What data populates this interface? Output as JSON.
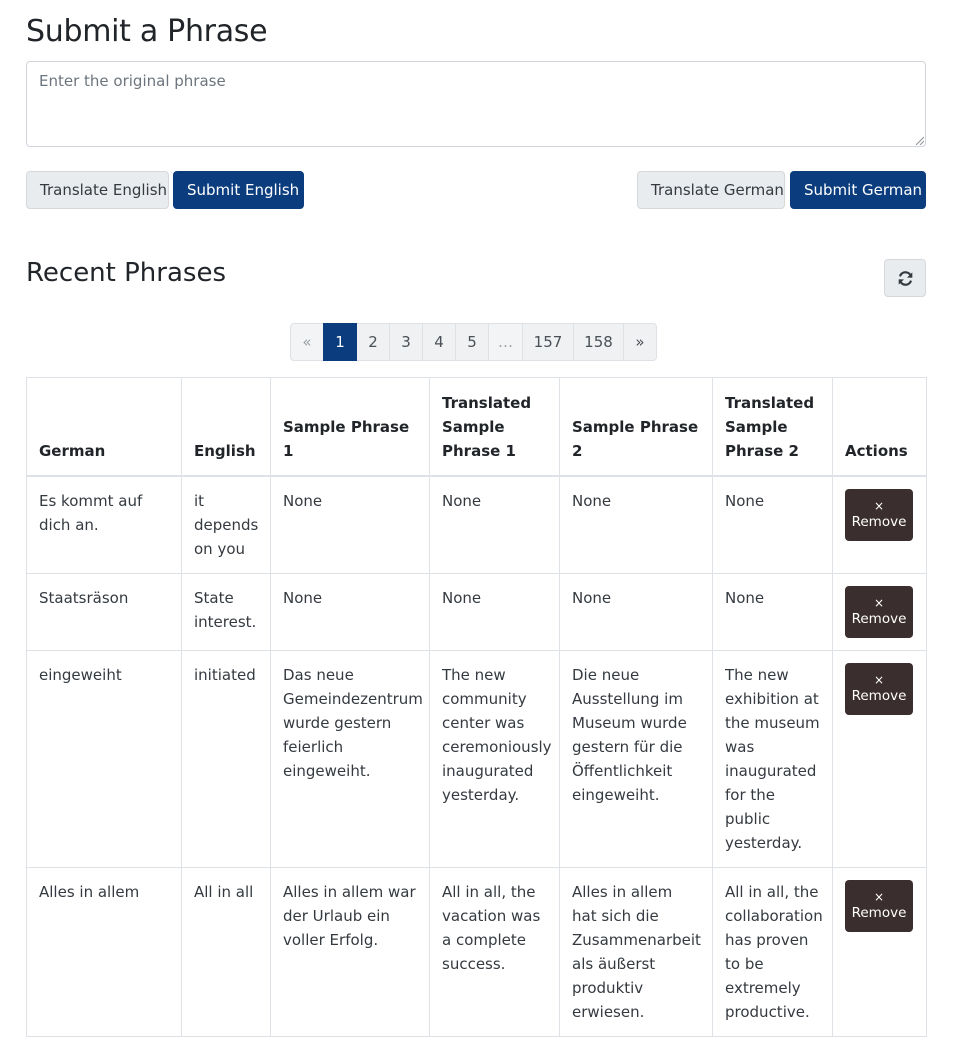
{
  "form": {
    "title": "Submit a Phrase",
    "placeholder": "Enter the original phrase",
    "translate_english": "Translate English",
    "submit_english": "Submit English",
    "translate_german": "Translate German",
    "submit_german": "Submit German"
  },
  "recent": {
    "title": "Recent Phrases"
  },
  "pagination": {
    "prev": "«",
    "next": "»",
    "pages": [
      "1",
      "2",
      "3",
      "4",
      "5",
      "…",
      "157",
      "158"
    ],
    "current": "1"
  },
  "table": {
    "headers": [
      "German",
      "English",
      "Sample Phrase 1",
      "Translated Sample Phrase 1",
      "Sample Phrase 2",
      "Translated Sample Phrase 2",
      "Actions"
    ],
    "remove_icon": "×",
    "remove_label": "Remove",
    "rows": [
      [
        "Es kommt auf dich an.",
        "it depends on you",
        "None",
        "None",
        "None",
        "None"
      ],
      [
        "Staatsräson",
        "State interest.",
        "None",
        "None",
        "None",
        "None"
      ],
      [
        "eingeweiht",
        "initiated",
        "Das neue Gemeindezentrum wurde gestern feierlich eingeweiht.",
        "The new community center was ceremoniously inaugurated yesterday.",
        "Die neue Ausstellung im Museum wurde gestern für die Öffentlichkeit eingeweiht.",
        "The new exhibition at the museum was inaugurated for the public yesterday."
      ],
      [
        "Alles in allem",
        "All in all",
        "Alles in allem war der Urlaub ein voller Erfolg.",
        "All in all, the vacation was a complete success.",
        "Alles in allem hat sich die Zusammenarbeit als äußerst produktiv erwiesen.",
        "All in all, the collaboration has proven to be extremely productive."
      ]
    ]
  },
  "colors": {
    "primary": "#0b3d7e",
    "remove": "#3b2e2e"
  }
}
